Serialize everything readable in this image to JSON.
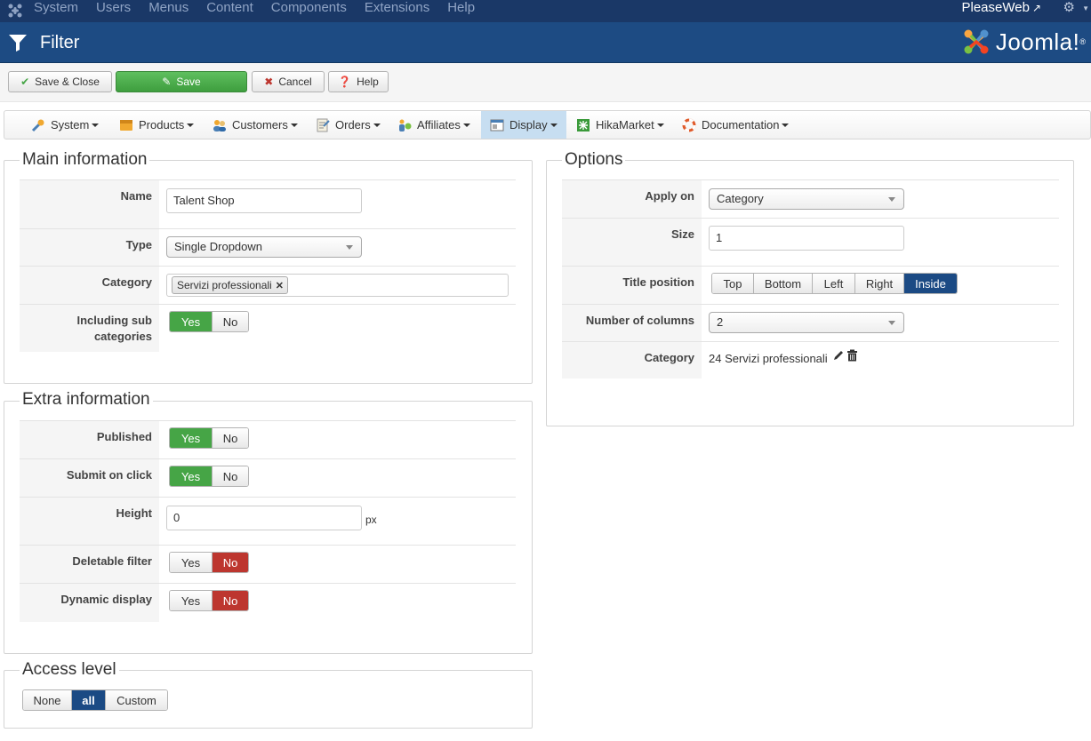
{
  "adminbar": {
    "menu": [
      "System",
      "Users",
      "Menus",
      "Content",
      "Components",
      "Extensions",
      "Help"
    ],
    "site_name": "PleaseWeb"
  },
  "titlebar": {
    "title": "Filter",
    "logo_text": "Joomla!"
  },
  "toolbar": {
    "save_close": "Save & Close",
    "save": "Save",
    "cancel": "Cancel",
    "help": "Help"
  },
  "hikamenu": {
    "items": [
      "System",
      "Products",
      "Customers",
      "Orders",
      "Affiliates",
      "Display",
      "HikaMarket",
      "Documentation"
    ],
    "active": "Display"
  },
  "main_info": {
    "legend": "Main information",
    "name_label": "Name",
    "name_value": "Talent Shop",
    "type_label": "Type",
    "type_value": "Single Dropdown",
    "category_label": "Category",
    "category_tag": "Servizi professionali",
    "sub_label": "Including sub categories",
    "sub_yes": "Yes",
    "sub_no": "No"
  },
  "extra_info": {
    "legend": "Extra information",
    "published_label": "Published",
    "submit_label": "Submit on click",
    "height_label": "Height",
    "height_value": "0",
    "height_unit": "px",
    "deletable_label": "Deletable filter",
    "dynamic_label": "Dynamic display",
    "yes": "Yes",
    "no": "No"
  },
  "access": {
    "legend": "Access level",
    "options": [
      "None",
      "all",
      "Custom"
    ],
    "selected": "all"
  },
  "options": {
    "legend": "Options",
    "apply_label": "Apply on",
    "apply_value": "Category",
    "size_label": "Size",
    "size_value": "1",
    "title_pos_label": "Title position",
    "title_positions": [
      "Top",
      "Bottom",
      "Left",
      "Right",
      "Inside"
    ],
    "title_pos_selected": "Inside",
    "columns_label": "Number of columns",
    "columns_value": "2",
    "category_label": "Category",
    "category_value": "24 Servizi professionali"
  },
  "colors": {
    "adminbar": "#1a3867",
    "titlebar": "#1d4b83",
    "green": "#46a546",
    "red": "#bd362f",
    "blue": "#1b4a84"
  }
}
